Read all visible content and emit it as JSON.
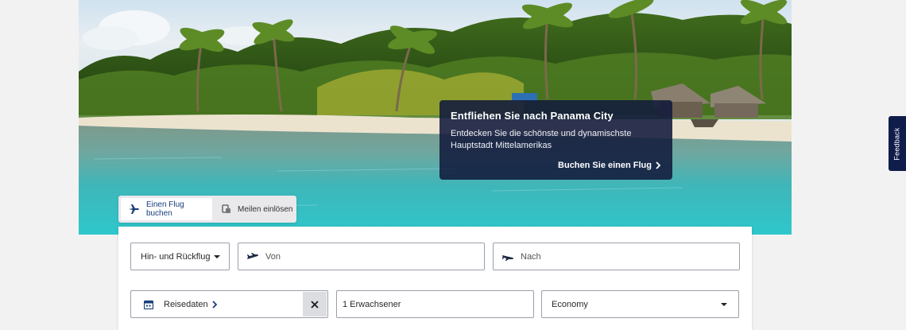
{
  "promo": {
    "title": "Entfliehen Sie nach Panama City",
    "text": "Entdecken Sie die schönste und dynamischste Hauptstadt Mittelamerikas",
    "cta": "Buchen Sie einen Flug"
  },
  "feedback": {
    "label": "Feedback"
  },
  "tabs": {
    "book": {
      "label": "Einen Flug buchen",
      "icon": "airplane-icon"
    },
    "redeem": {
      "label": "Meilen einlösen",
      "icon": "miles-icon"
    }
  },
  "search": {
    "trip_type": "Hin- und Rückflug",
    "from_placeholder": "Von",
    "to_placeholder": "Nach",
    "dates_label": "Reisedaten",
    "passengers": "1 Erwachsener",
    "cabin": "Economy"
  },
  "colors": {
    "brand_navy": "#101d4a",
    "tab_active_text": "#1a3d7c",
    "promo_bg": "#121a3c"
  }
}
